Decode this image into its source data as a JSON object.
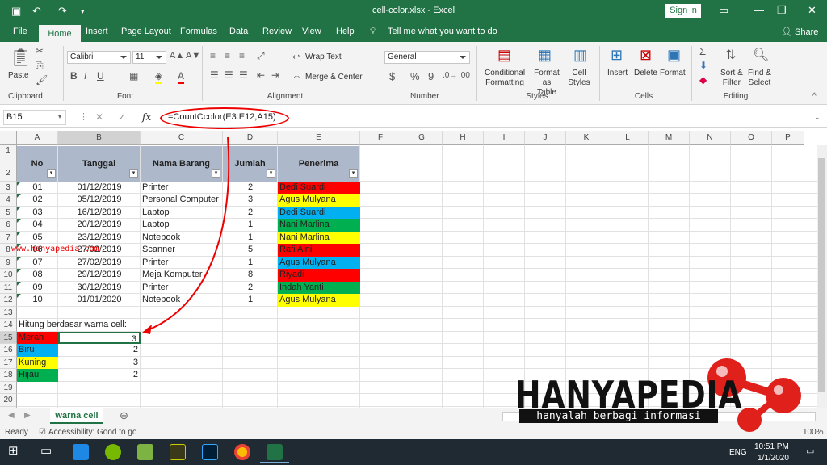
{
  "window": {
    "title": "cell-color.xlsx  -  Excel",
    "signin": "Sign in"
  },
  "tabs": [
    "File",
    "Home",
    "Insert",
    "Page Layout",
    "Formulas",
    "Data",
    "Review",
    "View",
    "Help"
  ],
  "tell_me": "Tell me what you want to do",
  "share": "Share",
  "ribbon": {
    "clipboard": {
      "paste": "Paste",
      "label": "Clipboard"
    },
    "font": {
      "name": "Calibri",
      "size": "11",
      "label": "Font"
    },
    "alignment": {
      "wrap": "Wrap Text",
      "merge": "Merge & Center",
      "label": "Alignment"
    },
    "number": {
      "format": "General",
      "label": "Number",
      "currency": "$",
      "percent": "%",
      "comma": "9"
    },
    "styles": {
      "cond": "Conditional",
      "cond2": "Formatting",
      "fmt_table": "Format as",
      "fmt_table2": "Table",
      "cell_styles": "Cell",
      "cell_styles2": "Styles",
      "label": "Styles"
    },
    "cells": {
      "insert": "Insert",
      "delete": "Delete",
      "format": "Format",
      "label": "Cells"
    },
    "editing": {
      "sort": "Sort &",
      "sort2": "Filter",
      "find": "Find &",
      "find2": "Select",
      "label": "Editing"
    }
  },
  "formula_bar": {
    "name_box": "B15",
    "formula": "=CountCcolor(E3:E12,A15)"
  },
  "columns": [
    "A",
    "B",
    "C",
    "D",
    "E",
    "F",
    "G",
    "H",
    "I",
    "J",
    "K",
    "L",
    "M",
    "N",
    "O",
    "P"
  ],
  "rows": [
    "1",
    "2",
    "3",
    "4",
    "5",
    "6",
    "7",
    "8",
    "9",
    "10",
    "11",
    "12",
    "13",
    "14",
    "15",
    "16",
    "17",
    "18",
    "19",
    "20",
    "21"
  ],
  "table": {
    "headers": [
      "No",
      "Tanggal",
      "Nama Barang",
      "Jumlah",
      "Penerima"
    ],
    "rows": [
      {
        "no": "01",
        "tanggal": "01/12/2019",
        "barang": "Printer",
        "jumlah": "2",
        "penerima": "Dedi Suardi",
        "color": "#ff0000"
      },
      {
        "no": "02",
        "tanggal": "05/12/2019",
        "barang": "Personal Computer",
        "jumlah": "3",
        "penerima": "Agus Mulyana",
        "color": "#ffff00"
      },
      {
        "no": "03",
        "tanggal": "16/12/2019",
        "barang": "Laptop",
        "jumlah": "2",
        "penerima": "Dedi Suardi",
        "color": "#00b0f0"
      },
      {
        "no": "04",
        "tanggal": "20/12/2019",
        "barang": "Laptop",
        "jumlah": "1",
        "penerima": "Nani Marlina",
        "color": "#00b050"
      },
      {
        "no": "05",
        "tanggal": "23/12/2019",
        "barang": "Notebook",
        "jumlah": "1",
        "penerima": "Nani Marlina",
        "color": "#ffff00"
      },
      {
        "no": "06",
        "tanggal": "27/02/2019",
        "barang": "Scanner",
        "jumlah": "5",
        "penerima": "Rafi Aini",
        "color": "#ff0000"
      },
      {
        "no": "07",
        "tanggal": "27/02/2019",
        "barang": "Printer",
        "jumlah": "1",
        "penerima": "Agus Mulyana",
        "color": "#00b0f0"
      },
      {
        "no": "08",
        "tanggal": "29/12/2019",
        "barang": "Meja Komputer",
        "jumlah": "8",
        "penerima": "Riyadi",
        "color": "#ff0000"
      },
      {
        "no": "09",
        "tanggal": "30/12/2019",
        "barang": "Printer",
        "jumlah": "2",
        "penerima": "Indah Yanti",
        "color": "#00b050"
      },
      {
        "no": "10",
        "tanggal": "01/01/2020",
        "barang": "Notebook",
        "jumlah": "1",
        "penerima": "Agus Mulyana",
        "color": "#ffff00"
      }
    ]
  },
  "count_title": "Hitung berdasar warna cell:",
  "counts": [
    {
      "label": "Merah",
      "value": "3",
      "color": "#ff0000"
    },
    {
      "label": "Biru",
      "value": "2",
      "color": "#00b0f0"
    },
    {
      "label": "Kuning",
      "value": "3",
      "color": "#ffff00"
    },
    {
      "label": "Hijau",
      "value": "2",
      "color": "#00b050"
    }
  ],
  "watermark": "www.hanyapedia.com",
  "sheet_tab": "warna cell",
  "status": {
    "ready": "Ready",
    "accessibility": "Accessibility: Good to go",
    "zoom": "100%"
  },
  "logo": {
    "word": "HANYAPEDIA",
    "tagline": "hanyalah berbagi informasi"
  },
  "taskbar": {
    "lang": "ENG",
    "time": "10:51 PM",
    "date": "1/1/2020"
  }
}
